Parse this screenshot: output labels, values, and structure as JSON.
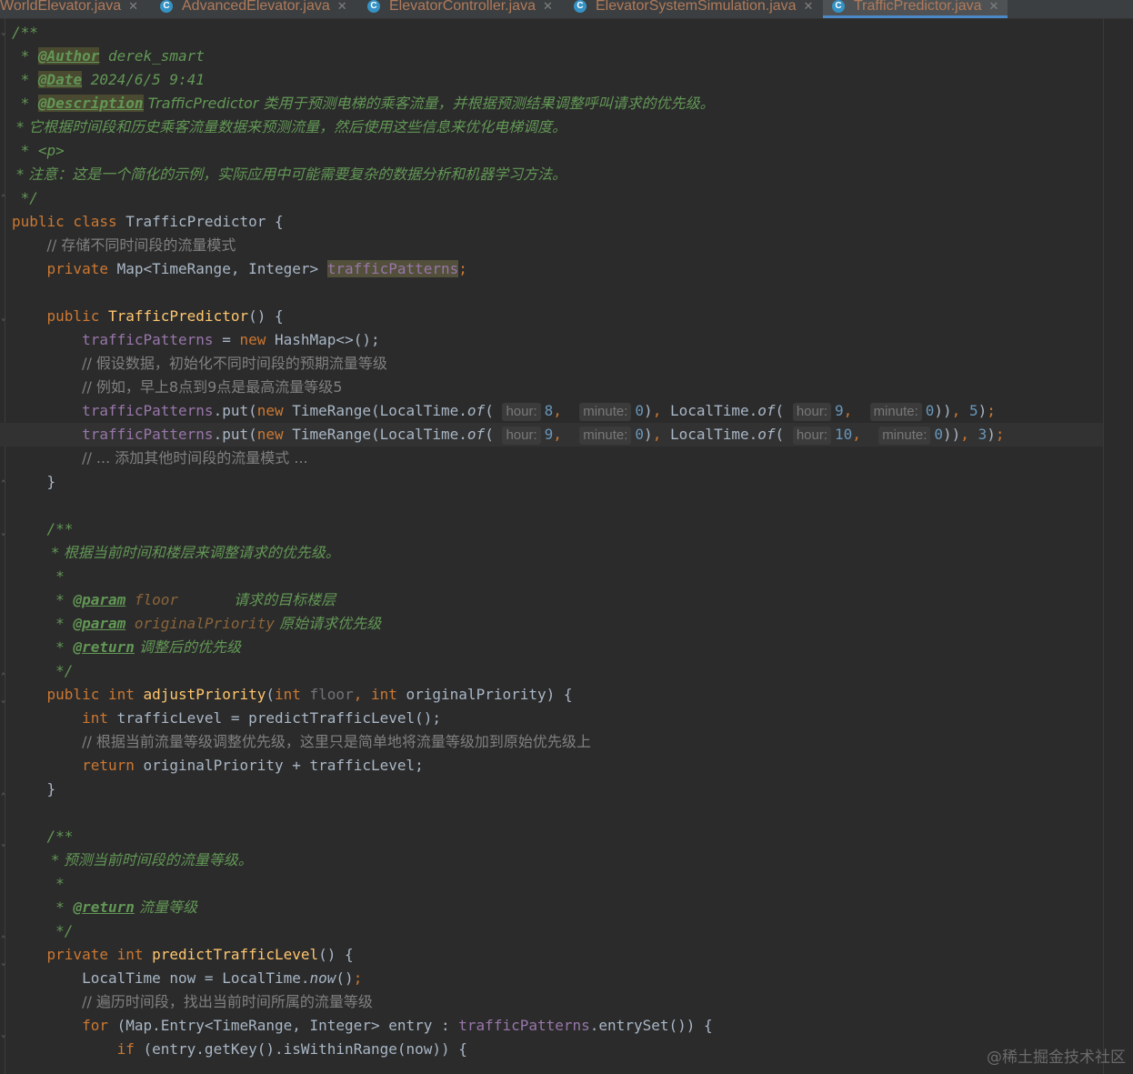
{
  "tabs": [
    {
      "label": "WorldElevator.java",
      "active": false
    },
    {
      "label": "AdvancedElevator.java",
      "active": false
    },
    {
      "label": "ElevatorController.java",
      "active": false
    },
    {
      "label": "ElevatorSystemSimulation.java",
      "active": false
    },
    {
      "label": "TrafficPredictor.java",
      "active": true
    }
  ],
  "code": {
    "doc_open": "/**",
    "author_tag": "@Author",
    "author_value": " derek_smart",
    "date_tag": "@Date",
    "date_value": " 2024/6/5 9:41",
    "desc_tag": "@Description",
    "desc_value": " TrafficPredictor 类用于预测电梯的乘客流量，并根据预测结果调整呼叫请求的优先级。",
    "doc_line2": " * 它根据时间段和历史乘客流量数据来预测流量，然后使用这些信息来优化电梯调度。",
    "doc_p": " * <p>",
    "doc_note": " * 注意：这是一个简化的示例，实际应用中可能需要复杂的数据分析和机器学习方法。",
    "doc_close": " */",
    "class_kw": "public class ",
    "class_name": "TrafficPredictor {",
    "cmt_patterns": "// 存储不同时间段的流量模式",
    "field_decl_kw": "private ",
    "field_decl_type": "Map<TimeRange, Integer> ",
    "field_name": "trafficPatterns",
    "ctor_kw": "public ",
    "ctor_name": "TrafficPredictor",
    "ctor_rest": "() {",
    "init_field": "trafficPatterns",
    "init_rest_a": " = ",
    "init_new": "new ",
    "init_rest_b": "HashMap<>();",
    "cmt_assume": "// 假设数据，初始化不同时间段的预期流量等级",
    "cmt_example": "// 例如，早上8点到9点是最高流量等级5",
    "put1": {
      "h1": "8",
      "m1": "0",
      "h2": "9",
      "m2": "0",
      "level": "5"
    },
    "put2": {
      "h1": "9",
      "m1": "0",
      "h2": "10",
      "m2": "0",
      "level": "3"
    },
    "hint_hour": "hour:",
    "hint_minute": "minute:",
    "cmt_more": "// ... 添加其他时间段的流量模式 ...",
    "brace_close": "}",
    "adj_doc_summary": " * 根据当前时间和楼层来调整请求的优先级。",
    "star": " *",
    "param_tag": "@param",
    "param1_name": " floor",
    "param1_desc": "            请求的目标楼层",
    "param2_name": " originalPriority",
    "param2_desc": " 原始请求优先级",
    "return_tag": "@return",
    "adj_return_desc": " 调整后的优先级",
    "adj_sig_kw": "public int ",
    "adj_name": "adjustPriority",
    "adj_params_a": "(",
    "adj_int": "int ",
    "adj_floor": "floor",
    "adj_params_b": ", ",
    "adj_params_c": "originalPriority) {",
    "adj_body1_kw": "int ",
    "adj_body1": "trafficLevel = predictTrafficLevel();",
    "adj_cmt": "// 根据当前流量等级调整优先级，这里只是简单地将流量等级加到原始优先级上",
    "adj_return_kw": "return ",
    "adj_return_expr": "originalPriority + trafficLevel;",
    "pred_doc_summary": " * 预测当前时间段的流量等级。",
    "pred_return_desc": " 流量等级",
    "pred_sig_kw": "private int ",
    "pred_name": "predictTrafficLevel",
    "pred_sig_rest": "() {",
    "pred_now": "LocalTime now = LocalTime.",
    "pred_now_m": "now",
    "pred_now_end": "();",
    "pred_cmt": "// 遍历时间段，找出当前时间所属的流量等级",
    "for_kw": "for ",
    "for_a": "(Map.Entry<TimeRange, Integer> entry : ",
    "for_field": "trafficPatterns",
    "for_b": ".entrySet()) {",
    "if_kw": "if ",
    "if_rest": "(entry.getKey().isWithinRange(now)) {"
  },
  "watermark": "@稀土掘金技术社区"
}
